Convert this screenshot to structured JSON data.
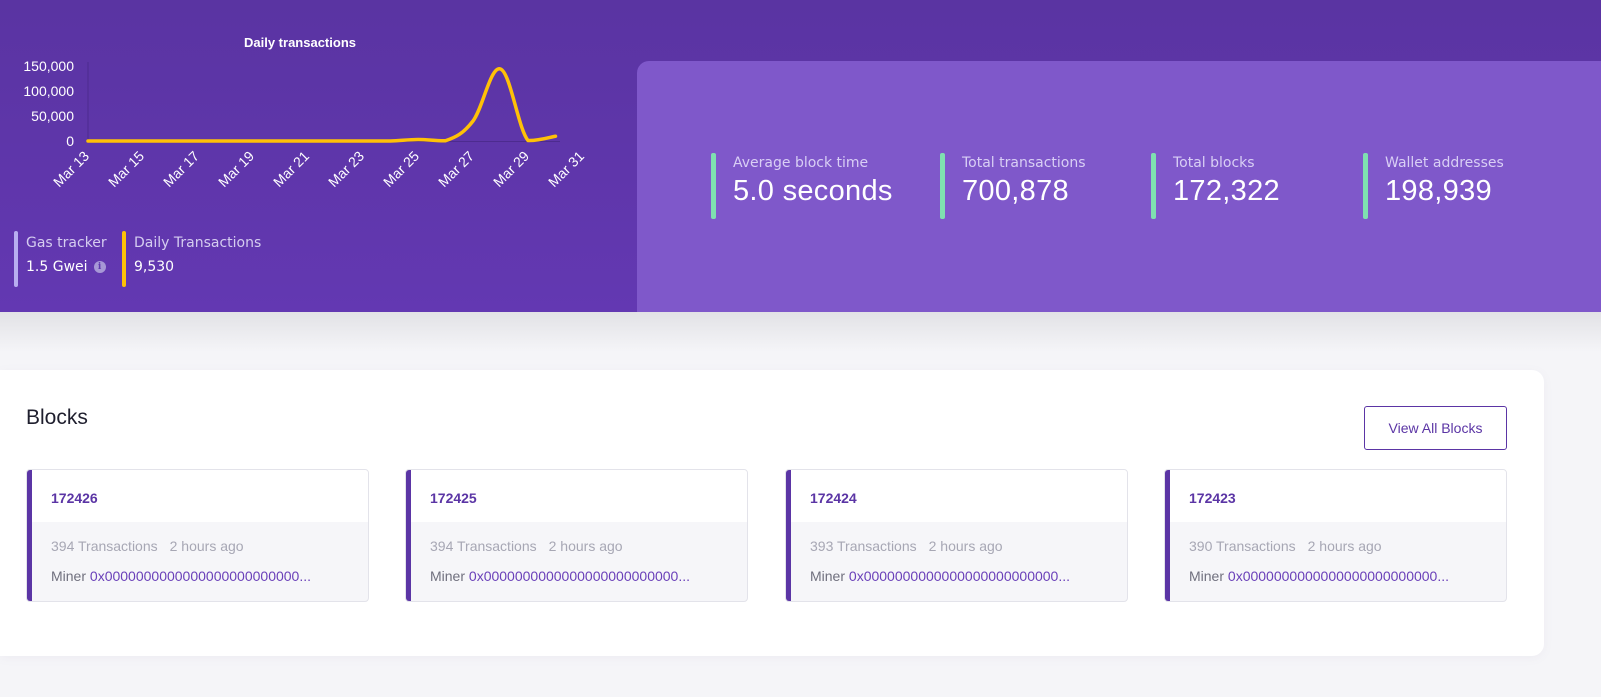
{
  "chart_data": {
    "type": "line",
    "title": "Daily transactions",
    "xlabel": "",
    "ylabel": "",
    "x": [
      "Mar 13",
      "Mar 14",
      "Mar 15",
      "Mar 16",
      "Mar 17",
      "Mar 18",
      "Mar 19",
      "Mar 20",
      "Mar 21",
      "Mar 22",
      "Mar 23",
      "Mar 24",
      "Mar 25",
      "Mar 26",
      "Mar 27",
      "Mar 28",
      "Mar 29",
      "Mar 30"
    ],
    "x_tick_labels": [
      "Mar 13",
      "Mar 15",
      "Mar 17",
      "Mar 19",
      "Mar 21",
      "Mar 23",
      "Mar 25",
      "Mar 27",
      "Mar 29",
      "Mar 31"
    ],
    "x_range": [
      "Mar 13",
      "Mar 31"
    ],
    "series": [
      {
        "name": "Daily transactions",
        "color": "#ffc107",
        "values": [
          0,
          0,
          0,
          0,
          0,
          0,
          0,
          0,
          0,
          0,
          0,
          0,
          3000,
          500,
          40000,
          144000,
          1000,
          9530
        ]
      }
    ],
    "y_ticks": [
      0,
      50000,
      100000,
      150000
    ],
    "y_tick_labels": [
      "0",
      "50,000",
      "100,000",
      "150,000"
    ],
    "ylim": [
      0,
      150000
    ],
    "grid": false,
    "legend": "none"
  },
  "hero": {
    "gas_tracker": {
      "label": "Gas tracker",
      "value": "1.5 Gwei",
      "bar_color": "#b8aef0"
    },
    "daily_transactions": {
      "label": "Daily Transactions",
      "value": "9,530",
      "bar_color": "#ffc107"
    }
  },
  "stats": [
    {
      "label": "Average block time",
      "value": "5.0 seconds"
    },
    {
      "label": "Total transactions",
      "value": "700,878"
    },
    {
      "label": "Total blocks",
      "value": "172,322"
    },
    {
      "label": "Wallet addresses",
      "value": "198,939"
    }
  ],
  "blocks": {
    "title": "Blocks",
    "view_all_label": "View All Blocks",
    "items": [
      {
        "number": "172426",
        "transactions": "394 Transactions",
        "time": "2 hours ago",
        "miner_label": "Miner",
        "miner": "0x0000000000000000000000000..."
      },
      {
        "number": "172425",
        "transactions": "394 Transactions",
        "time": "2 hours ago",
        "miner_label": "Miner",
        "miner": "0x0000000000000000000000000..."
      },
      {
        "number": "172424",
        "transactions": "393 Transactions",
        "time": "2 hours ago",
        "miner_label": "Miner",
        "miner": "0x0000000000000000000000000..."
      },
      {
        "number": "172423",
        "transactions": "390 Transactions",
        "time": "2 hours ago",
        "miner_label": "Miner",
        "miner": "0x0000000000000000000000000..."
      }
    ]
  },
  "colors": {
    "hero_bg": "#5c35a6",
    "stats_panel_bg": "#7f58ca",
    "stat_accent": "#7fe0b0",
    "brand_purple": "#5b35a5",
    "chart_line": "#ffc107"
  }
}
